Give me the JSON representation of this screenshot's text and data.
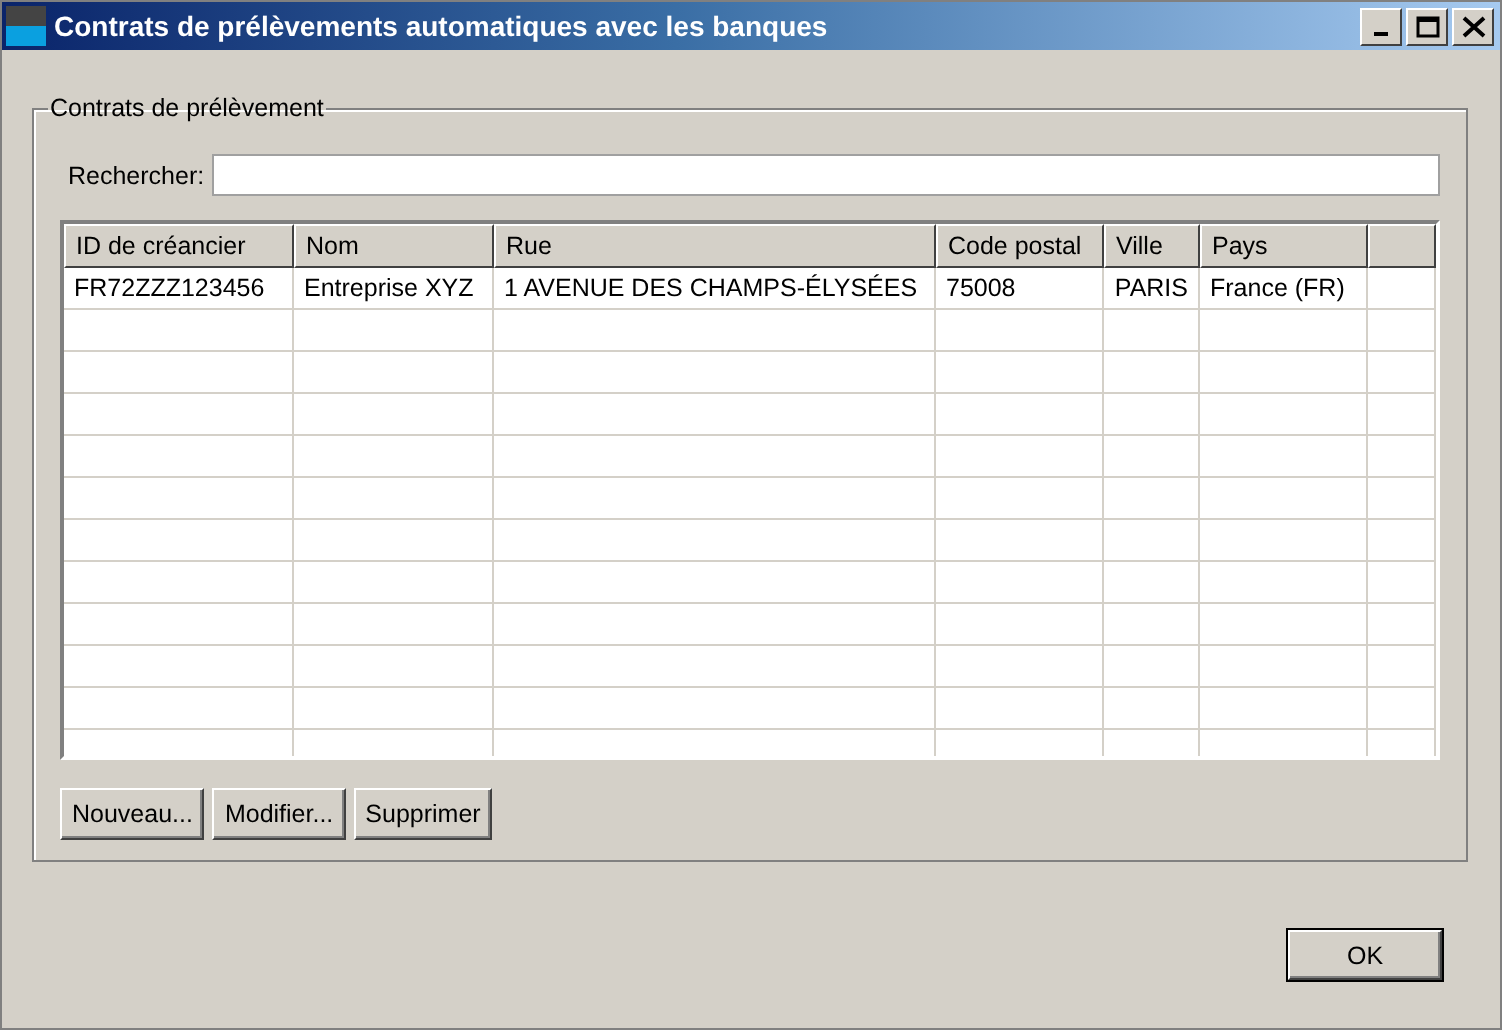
{
  "window": {
    "title": "Contrats de prélèvements automatiques avec les banques"
  },
  "group": {
    "title": "Contrats de prélèvement"
  },
  "search": {
    "label": "Rechercher:"
  },
  "table": {
    "columns": [
      "ID de créancier",
      "Nom",
      "Rue",
      "Code postal",
      "Ville",
      "Pays"
    ],
    "rows": [
      [
        "FR72ZZZ123456",
        "Entreprise XYZ",
        "1 AVENUE DES CHAMPS-ÉLYSÉES",
        "75008",
        "PARIS",
        "France (FR)"
      ]
    ]
  },
  "actions": [
    "Nouveau...",
    "Modifier...",
    "Supprimer"
  ],
  "buttons": [
    "OK"
  ]
}
